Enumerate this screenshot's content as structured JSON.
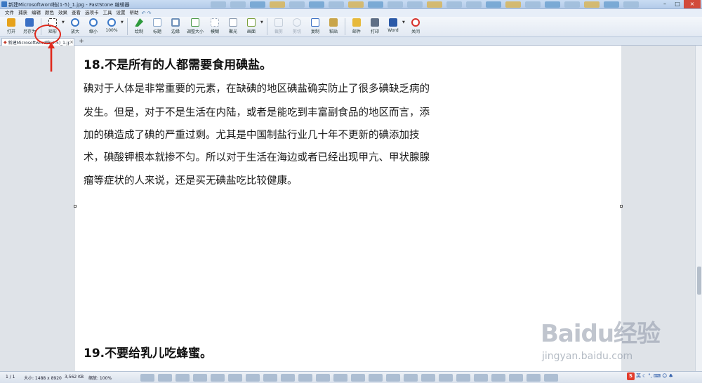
{
  "window": {
    "title": "新建Microsoftword档(1-5)_1.jpg - FastStone 编辑器"
  },
  "menu": {
    "items": [
      "文件",
      "捕获",
      "编辑",
      "颜色",
      "效果",
      "查看",
      "选项卡",
      "工具",
      "设置",
      "帮助"
    ]
  },
  "toolbar": {
    "buttons": [
      {
        "label": "打开",
        "icon": "open-folder-icon",
        "color": "#e6a21c"
      },
      {
        "label": "另存为",
        "icon": "save-icon",
        "color": "#3a6fc4"
      },
      {
        "label": "矩形",
        "icon": "rectangle-select-icon",
        "color": "#ffffff"
      },
      {
        "label": "放大",
        "icon": "zoom-in-icon",
        "color": "#3a78c8"
      },
      {
        "label": "缩小",
        "icon": "zoom-out-icon",
        "color": "#3a78c8"
      },
      {
        "label": "100%",
        "icon": "zoom-100-icon",
        "color": "#3a78c8"
      },
      {
        "label": "绘制",
        "icon": "draw-icon",
        "color": "#2e9a3c"
      },
      {
        "label": "标题",
        "icon": "caption-icon",
        "color": "#8aa7c9"
      },
      {
        "label": "边缘",
        "icon": "edge-icon",
        "color": "#6d8fb8"
      },
      {
        "label": "调整大小",
        "icon": "resize-icon",
        "color": "#4b9a4a"
      },
      {
        "label": "模糊",
        "icon": "blur-icon",
        "color": "#8a9ab0"
      },
      {
        "label": "聚光",
        "icon": "spotlight-icon",
        "color": "#8a9ab0"
      },
      {
        "label": "画面",
        "icon": "canvas-icon",
        "color": "#7aa03c"
      },
      {
        "label": "裁剪",
        "icon": "crop-icon",
        "color": "#8a9ab0"
      },
      {
        "label": "剪切",
        "icon": "cut-icon",
        "color": "#8a9ab0"
      },
      {
        "label": "复制",
        "icon": "copy-icon",
        "color": "#3a6fc4"
      },
      {
        "label": "粘贴",
        "icon": "paste-icon",
        "color": "#c9a54a"
      },
      {
        "label": "邮件",
        "icon": "mail-icon",
        "color": "#e7b93b"
      },
      {
        "label": "打印",
        "icon": "print-icon",
        "color": "#5f6f86"
      },
      {
        "label": "Word",
        "icon": "word-icon",
        "color": "#2b5aa8"
      },
      {
        "label": "关闭",
        "icon": "close-power-icon",
        "color": "#d6302a"
      }
    ]
  },
  "tabs": {
    "active_label": "新建Microsoftword档(1-5)_1.jpg",
    "add_label": "+"
  },
  "document": {
    "heading_18": "18.不是所有的人都需要食用碘盐。",
    "paragraph_lines": [
      "碘对于人体是非常重要的元素，在缺碘的地区碘盐确实防止了很多碘缺乏病的",
      "发生。但是，对于不是生活在内陆，或者是能吃到丰富副食品的地区而言，添",
      "加的碘造成了碘的严重过剩。尤其是中国制盐行业几十年不更新的碘添加技",
      "术，碘酸钾根本就掺不匀。所以对于生活在海边或者已经出现甲亢、甲状腺腺",
      "瘤等症状的人来说，还是买无碘盐吃比较健康。"
    ],
    "heading_19": "19.不要给乳儿吃蜂蜜。"
  },
  "statusbar": {
    "page": "1 / 1",
    "size": "大小: 1488 x 8920",
    "filesize": "3,562 KB",
    "zoom": "缩放: 100%"
  },
  "ime": {
    "logo": "S",
    "mode": "英"
  },
  "watermark": {
    "logo": "Baidu经验",
    "url": "jingyan.baidu.com"
  },
  "colors": {
    "annotation": "#e0291c"
  }
}
